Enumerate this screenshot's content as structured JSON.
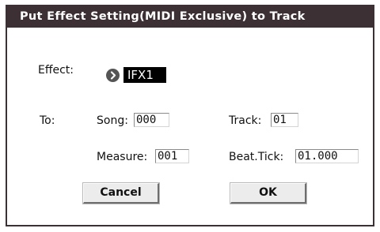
{
  "dialog": {
    "title": "Put Effect Setting(MIDI Exclusive) to Track",
    "effect_label": "Effect:",
    "effect_value": "IFX1",
    "to_label": "To:",
    "song_label": "Song:",
    "song_value": "000",
    "track_label": "Track:",
    "track_value": "01",
    "measure_label": "Measure:",
    "measure_value": "001",
    "beat_tick_label": "Beat.Tick:",
    "beat_tick_value": "01.000",
    "cancel_label": "Cancel",
    "ok_label": "OK"
  },
  "icons": {
    "effect_select": "circle-arrow-right-icon"
  },
  "colors": {
    "titlebar": "#3c3035",
    "selected_value_bg": "#000000",
    "button_face": "#ececec"
  }
}
